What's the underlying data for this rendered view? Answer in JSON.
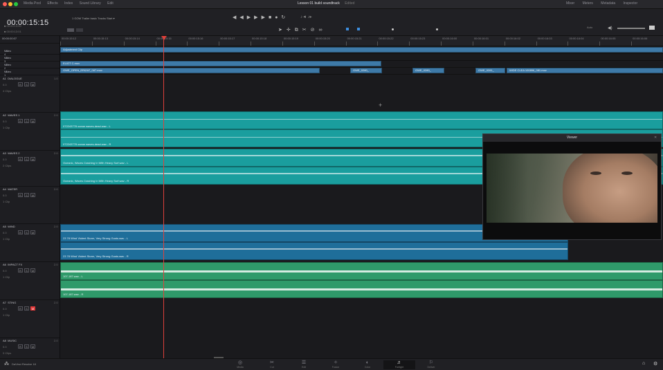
{
  "window": {
    "title": "Lesson 01 build soundtrack",
    "title_suffix": "Edited"
  },
  "toolbar_top": {
    "left_items": [
      "Media Pool",
      "Effects",
      "Index",
      "Sound Library",
      "Edit"
    ],
    "right_items": [
      "Mixer",
      "Meters",
      "Metadata",
      "Inspector"
    ]
  },
  "header": {
    "timecode": "00:00:15:15",
    "timeline_name": "1 GOW Trailer basic Tracks Start",
    "timecode_rows": [
      "00:00:13:00",
      "00:00:13:01",
      "00:00:00:07"
    ],
    "zoom_label": "Auto"
  },
  "ruler": {
    "ticks": [
      "00:00:15:12",
      "00:00:15:13",
      "00:00:15:14",
      "00:00:15:15",
      "00:00:15:16",
      "00:00:15:17",
      "00:00:15:18",
      "00:00:15:19",
      "00:00:15:20",
      "00:00:15:21",
      "00:00:15:22",
      "00:00:15:23",
      "00:00:16:00",
      "00:00:16:01",
      "00:00:16:02",
      "00:00:16:03",
      "00:00:16:04",
      "00:00:16:05",
      "00:00:16:06"
    ]
  },
  "video_tracks": [
    {
      "id": "V4",
      "name": "Video 4"
    },
    {
      "id": "V3",
      "name": "Video 3"
    },
    {
      "id": "V2",
      "name": "Video 2"
    },
    {
      "id": "V1",
      "name": "Video 1"
    }
  ],
  "video_clips": [
    {
      "label": "Adjustment Clip"
    },
    {
      "label": "ELIOT C.mov"
    },
    {
      "label": "GWE_OPEN_ERIZAT_087.mov"
    },
    {
      "label": "GWE_0280_"
    },
    {
      "label": "GWE_0280_"
    },
    {
      "label": "GWE_0281_"
    },
    {
      "label": "WIDE CLEA 100896_081.mov"
    }
  ],
  "audio_tracks": [
    {
      "id": "A1",
      "name": "DIALOGUE",
      "level": "1.0",
      "clips": "4 Clips",
      "vol": "0.0"
    },
    {
      "id": "A2",
      "name": "WAVES 1",
      "level": "2.0",
      "clips": "1 Clip",
      "vol": "0.0"
    },
    {
      "id": "A3",
      "name": "WAVES 2",
      "level": "2.0",
      "clips": "2 Clips",
      "vol": "0.0"
    },
    {
      "id": "A4",
      "name": "WATER",
      "level": "2.0",
      "clips": "1 Clip",
      "vol": "0.0"
    },
    {
      "id": "A5",
      "name": "WIND",
      "level": "2.0",
      "clips": "1 Clip",
      "vol": "0.0"
    },
    {
      "id": "A6",
      "name": "IMPACT FX",
      "level": "2.0",
      "clips": "1 Clip",
      "vol": "0.0"
    },
    {
      "id": "A7",
      "name": "STING",
      "level": "2.0",
      "clips": "1 Clip",
      "vol": "0.0"
    },
    {
      "id": "A8",
      "name": "MUSIC",
      "level": "2.0",
      "clips": "0 Clips",
      "vol": "0.0"
    }
  ],
  "audio_clips": {
    "waves1_a": "072243778 ocean waves-dead.wav - L",
    "waves1_b": "072243778 ocean waves-dead.wav - R",
    "waves2_a": "Oceanic, Waves Crashing In With Heavy Surf.wav - L",
    "waves2_b": "Oceanic, Waves Crashing In With Heavy Surf.wav - R",
    "wind_a": "23 78 Wind Violent Storm, Very Strong Gusts.wav - L",
    "wind_b": "23 78 Wind Violent Storm, Very Strong Gusts.wav - R",
    "impact_a": "107-187.wav - L",
    "impact_b": "107-187.wav - R"
  },
  "track_buttons": [
    "R",
    "S",
    "M"
  ],
  "viewer": {
    "title": "Viewer"
  },
  "bottom": {
    "app_name": "DaVinci Resolve 18",
    "pages": [
      {
        "label": "Media",
        "icon": "◎"
      },
      {
        "label": "Cut",
        "icon": "✂"
      },
      {
        "label": "Edit",
        "icon": "☰"
      },
      {
        "label": "Fusion",
        "icon": "✧"
      },
      {
        "label": "Color",
        "icon": "◐"
      },
      {
        "label": "Fairlight",
        "icon": "♬"
      },
      {
        "label": "Deliver",
        "icon": "⚐"
      }
    ],
    "active_page": "Fairlight"
  },
  "colors": {
    "video_clip": "#3e7aa8",
    "waves_clip": "#1a9e9e",
    "wind_clip": "#1f6e9a",
    "impact_clip": "#2f9a6a",
    "playhead": "#e0413b"
  }
}
